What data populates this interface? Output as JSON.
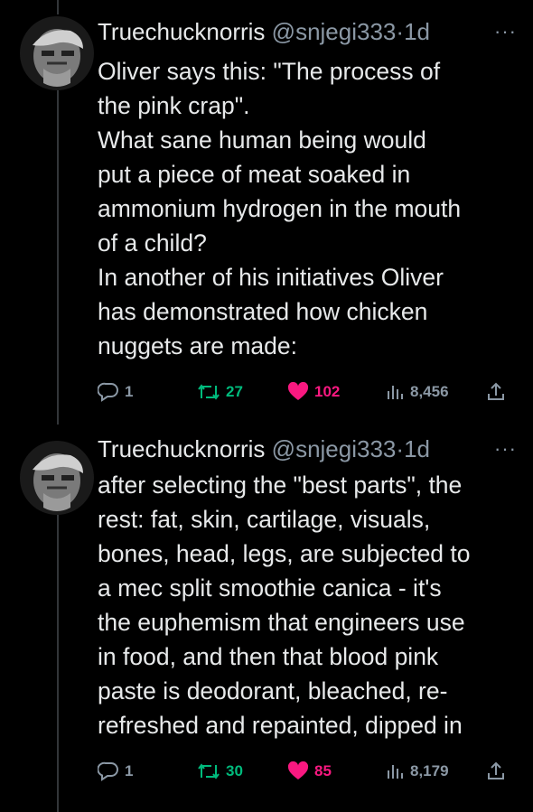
{
  "tweets": [
    {
      "display_name": "Truechucknorris",
      "handle": "@snjegi333",
      "separator": "·",
      "time": "1d",
      "more": "···",
      "lines": [
        "Oliver says this: \"The process of",
        "the pink crap\".",
        "What sane human being would",
        "put a piece of meat soaked in",
        "ammonium hydrogen in the mouth",
        "of a child?",
        "In another of his initiatives Oliver",
        "has demonstrated how chicken",
        "nuggets are made:"
      ],
      "replies": "1",
      "retweets": "27",
      "likes": "102",
      "views": "8,456"
    },
    {
      "display_name": "Truechucknorris",
      "handle": "@snjegi333",
      "separator": "·",
      "time": "1d",
      "more": "···",
      "lines": [
        "after selecting the \"best parts\", the",
        "rest: fat, skin, cartilage, visuals,",
        "bones, head, legs, are subjected to",
        "a mec split smoothie canica - it's",
        "the euphemism that engineers use",
        "in food, and then that blood pink",
        "paste is deodorant, bleached, re-",
        "refreshed and repainted, dipped in"
      ],
      "replies": "1",
      "retweets": "30",
      "likes": "85",
      "views": "8,179"
    }
  ],
  "icons": {
    "reply": "reply-icon",
    "retweet": "retweet-icon",
    "like": "heart-icon",
    "views": "views-icon",
    "share": "share-icon"
  },
  "colors": {
    "background": "#000000",
    "text": "#e7e9ea",
    "muted": "#8b98a5",
    "retweet": "#00ba7c",
    "like": "#f91880",
    "thread_line": "#333639"
  }
}
